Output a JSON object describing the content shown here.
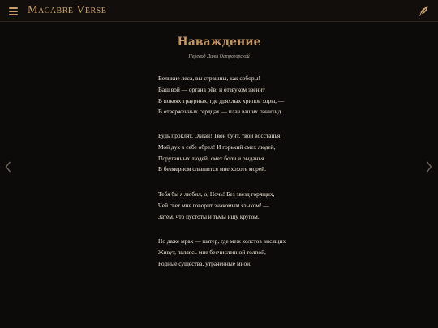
{
  "header": {
    "brand": "Macabre Verse",
    "menu_icon": "hamburger-menu-icon",
    "quill_icon": "quill-feather-icon"
  },
  "navigation": {
    "prev_icon": "chevron-left-icon",
    "next_icon": "chevron-right-icon"
  },
  "poem": {
    "title": "Наваждение",
    "translator": "Перевод Лины Острогорской",
    "stanzas": [
      {
        "lines": [
          "Великие леса, вы страшны, как соборы!",
          "Ваш вой — органа рёв; и отзвуком звенит",
          "В покоях траурных, где дряхлых хрипов хоры, —",
          "В отверженных сердцах — плач ваших панихид."
        ]
      },
      {
        "lines": [
          "Будь проклят, Океан! Твой бунт, твои восстанья",
          "Мой дух в себе обрел! И горький смех людей,",
          "Поруганных людей, смех боли и рыданья",
          "В безмерном слышится мне хохоте морей."
        ]
      },
      {
        "lines": [
          "Тебя бы я любил, о, Ночь! Без звезд горящих,",
          "Чей свет мне говорит знакомым языком! —",
          "Затем, что пустоты и тьмы ищу кругом."
        ]
      },
      {
        "lines": [
          "Но даже мрак — шатер, где меж холстов висящих",
          "Живут, являясь мне бесчисленной толпой,",
          "Родные существа, утраченные мной."
        ]
      }
    ]
  },
  "colors": {
    "background": "#0d0b09",
    "accent": "#c9a06a",
    "title": "#c39560",
    "text": "#ece5d8"
  }
}
